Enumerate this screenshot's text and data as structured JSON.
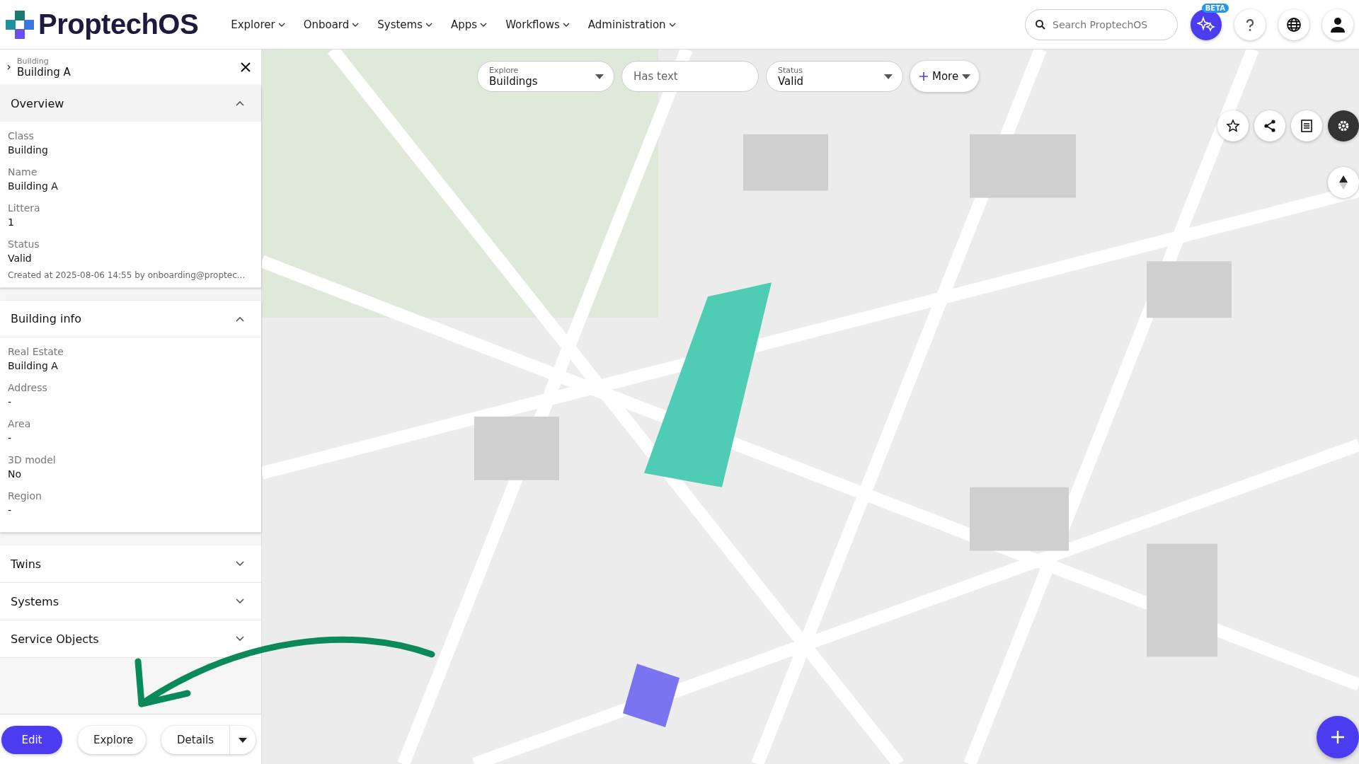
{
  "app": {
    "logo_text": "ProptechOS"
  },
  "nav": [
    {
      "label": "Explorer"
    },
    {
      "label": "Onboard"
    },
    {
      "label": "Systems"
    },
    {
      "label": "Apps"
    },
    {
      "label": "Workflows"
    },
    {
      "label": "Administration"
    }
  ],
  "search": {
    "placeholder": "Search ProptechOS"
  },
  "ai_button": {
    "badge": "BETA"
  },
  "panel": {
    "breadcrumb_label": "Building",
    "title": "Building A",
    "sections": [
      {
        "title": "Overview",
        "expanded": true,
        "fields": [
          {
            "label": "Class",
            "value": "Building"
          },
          {
            "label": "Name",
            "value": "Building A"
          },
          {
            "label": "Littera",
            "value": "1"
          },
          {
            "label": "Status",
            "value": "Valid"
          }
        ],
        "footnote": "Created at 2025-08-06 14:55 by onboarding@proptec..."
      },
      {
        "title": "Building info",
        "expanded": true,
        "fields": [
          {
            "label": "Real Estate",
            "value": "Building A"
          },
          {
            "label": "Address",
            "value": "-"
          },
          {
            "label": "Area",
            "value": "-"
          },
          {
            "label": "3D model",
            "value": "No"
          },
          {
            "label": "Region",
            "value": "-"
          }
        ]
      },
      {
        "title": "Twins",
        "expanded": false
      },
      {
        "title": "Systems",
        "expanded": false
      },
      {
        "title": "Service Objects",
        "expanded": false
      }
    ],
    "buttons": [
      {
        "label": "Edit",
        "kind": "primary"
      },
      {
        "label": "Explore",
        "kind": "secondary"
      },
      {
        "label": "Details",
        "kind": "split"
      }
    ]
  },
  "filters": [
    {
      "kind": "select",
      "label": "Explore",
      "value": "Buildings"
    },
    {
      "kind": "text",
      "placeholder": "Has text"
    },
    {
      "kind": "select",
      "label": "Status",
      "value": "Valid"
    },
    {
      "kind": "more",
      "label": "More"
    }
  ]
}
